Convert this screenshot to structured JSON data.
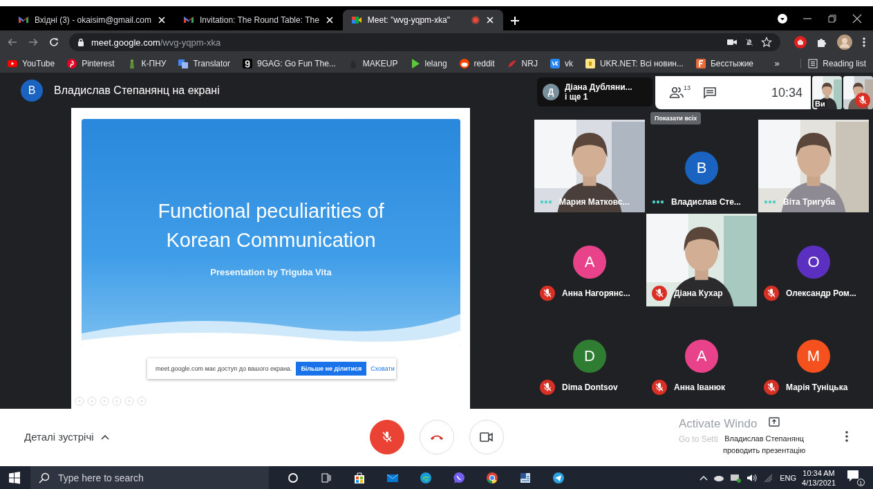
{
  "browser": {
    "tabs": [
      {
        "title": "Вхідні (3) - okaisim@gmail.com",
        "selected": false,
        "recording": false
      },
      {
        "title": "Invitation: The Round Table: The",
        "selected": false,
        "recording": false
      },
      {
        "title": "Meet: \"wvg-yqpm-xka\"",
        "selected": true,
        "recording": true
      }
    ],
    "url": "meet.google.com/wvg-yqpm-xka",
    "bookmarks": [
      {
        "label": "YouTube"
      },
      {
        "label": "Pinterest"
      },
      {
        "label": "К-ПНУ"
      },
      {
        "label": "Translator"
      },
      {
        "label": "9GAG: Go Fun The..."
      },
      {
        "label": "MAKEUP"
      },
      {
        "label": "lelang"
      },
      {
        "label": "reddit"
      },
      {
        "label": "NRJ"
      },
      {
        "label": "vk"
      },
      {
        "label": "UKR.NET: Всі новин..."
      },
      {
        "label": "Бесстыжие"
      }
    ],
    "bookmarks_more": "»",
    "reading_list": "Reading list"
  },
  "meet": {
    "presenter_avatar": "В",
    "presenting_title": "Владислав Степанянц на екрані",
    "slide": {
      "title": "Functional peculiarities of Korean Communication",
      "subtitle": "Presentation by Triguba Vita"
    },
    "share_notice": {
      "text": "meet.google.com має доступ до вашого екрана.",
      "stop_button": "Більше не ділитися",
      "hide_link": "Сховати"
    },
    "speaker": {
      "avatar": "Д",
      "name": "Діана Дубляни...",
      "more": "і ще 1"
    },
    "people_count": "13",
    "clock": "10:34",
    "tooltip": "Показати всіх",
    "self_views": [
      {
        "label": "Ви",
        "muted": false
      },
      {
        "muted": true
      }
    ],
    "participants": [
      {
        "name": "Мария Матковс...",
        "kind": "video",
        "muted": false
      },
      {
        "name": "Владислав Сте...",
        "kind": "avatar",
        "initial": "B",
        "color": "#1a63c0",
        "muted": false
      },
      {
        "name": "Віта Тригуба",
        "kind": "video",
        "muted": false
      },
      {
        "name": "Анна Нагорянс...",
        "kind": "avatar",
        "initial": "A",
        "color": "#e8438a",
        "muted": true
      },
      {
        "name": "Діана Кухар",
        "kind": "video",
        "muted": true
      },
      {
        "name": "Олександр Ром...",
        "kind": "avatar",
        "initial": "O",
        "color": "#5b2fbf",
        "muted": true
      },
      {
        "name": "Dima Dontsov",
        "kind": "avatar",
        "initial": "D",
        "color": "#2e7d32",
        "muted": true
      },
      {
        "name": "Анна Іванюк",
        "kind": "avatar",
        "initial": "A",
        "color": "#e8438a",
        "muted": true
      },
      {
        "name": "Марія Туніцька",
        "kind": "avatar",
        "initial": "M",
        "color": "#f4511e",
        "muted": true
      }
    ],
    "details": "Деталі зустрічі",
    "mic_muted": true,
    "camera_on": true,
    "presenter_notice": {
      "name": "Владислав Степанянц",
      "action": "проводить презентацію"
    }
  },
  "windows_activation": {
    "title": "Activate Windo",
    "subtitle": "Go to Setti"
  },
  "taskbar": {
    "search_placeholder": "Type here to search",
    "apps": [
      {
        "kind": "cortana"
      },
      {
        "kind": "task-view"
      },
      {
        "kind": "store"
      },
      {
        "kind": "mail"
      },
      {
        "kind": "edge"
      },
      {
        "kind": "viber"
      },
      {
        "kind": "chrome"
      },
      {
        "kind": "word"
      },
      {
        "kind": "telegram"
      }
    ],
    "language": "ENG",
    "time": "10:34 AM",
    "date": "4/13/2021",
    "notifications": "1"
  }
}
